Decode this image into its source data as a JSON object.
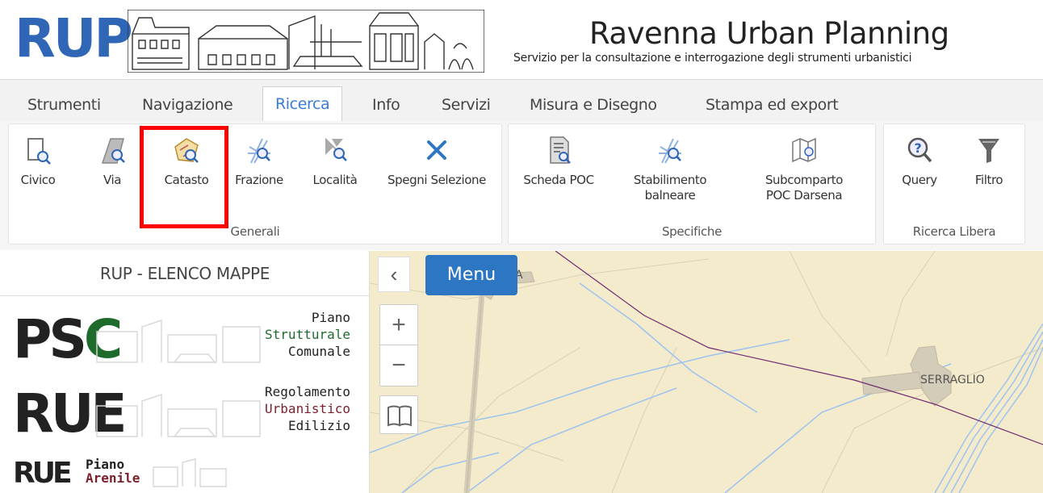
{
  "header": {
    "logo_text": "RUP",
    "title": "Ravenna Urban Planning",
    "subtitle": "Servizio per la consultazione e interrogazione degli strumenti urbanistici"
  },
  "tabs": [
    {
      "label": "Strumenti",
      "active": false
    },
    {
      "label": "Navigazione",
      "active": false
    },
    {
      "label": "Ricerca",
      "active": true
    },
    {
      "label": "Info",
      "active": false
    },
    {
      "label": "Servizi",
      "active": false
    },
    {
      "label": "Misura e Disegno",
      "active": false
    },
    {
      "label": "Stampa ed export",
      "active": false
    }
  ],
  "ribbon": {
    "groups": [
      {
        "label": "Generali",
        "tools": [
          {
            "label": "Civico",
            "icon": "civico-search-icon"
          },
          {
            "label": "Via",
            "icon": "street-search-icon"
          },
          {
            "label": "Catasto",
            "icon": "cadastre-search-icon",
            "highlighted": true
          },
          {
            "label": "Frazione",
            "icon": "hamlet-search-icon"
          },
          {
            "label": "Località",
            "icon": "locality-search-icon"
          },
          {
            "label": "Spegni Selezione",
            "icon": "clear-selection-icon"
          }
        ]
      },
      {
        "label": "Specifiche",
        "tools": [
          {
            "label": "Scheda POC",
            "icon": "poc-sheet-icon"
          },
          {
            "label_line1": "Stabilimento",
            "label_line2": "balneare",
            "icon": "bathing-establishment-icon"
          },
          {
            "label_line1": "Subcomparto",
            "label_line2": "POC Darsena",
            "icon": "subcomparto-map-icon"
          }
        ]
      },
      {
        "label": "Ricerca Libera",
        "tools": [
          {
            "label": "Query",
            "icon": "query-icon"
          },
          {
            "label": "Filtro",
            "icon": "filter-icon"
          }
        ]
      }
    ]
  },
  "left_panel": {
    "title": "RUP - ELENCO MAPPE",
    "maps": [
      {
        "abbr_part1": "PS",
        "abbr_part2": "C",
        "line1": "Piano",
        "line2": "Strutturale",
        "line3": "Comunale",
        "accent": "#1f6b2c"
      },
      {
        "abbr": "RUE",
        "line1": "Regolamento",
        "line2": "Urbanistico",
        "line3": "Edilizio",
        "accent": "#7a1f2b"
      },
      {
        "abbr": "RUE",
        "line1": "Piano",
        "line2": "Arenile",
        "accent": "#7a1f2b"
      }
    ]
  },
  "map": {
    "menu_label": "Menu",
    "collapse_glyph": "‹",
    "zoom_in": "+",
    "zoom_out": "−",
    "place_label": "SERRAGLIO",
    "partial_label": "A"
  },
  "colors": {
    "brand_blue": "#2f67b6",
    "menu_blue": "#2d76c4",
    "active_tab": "#3a7bd5",
    "highlight_red": "#ff0000",
    "map_bg": "#f4ebcd",
    "water_blue": "#8fb8e8"
  }
}
